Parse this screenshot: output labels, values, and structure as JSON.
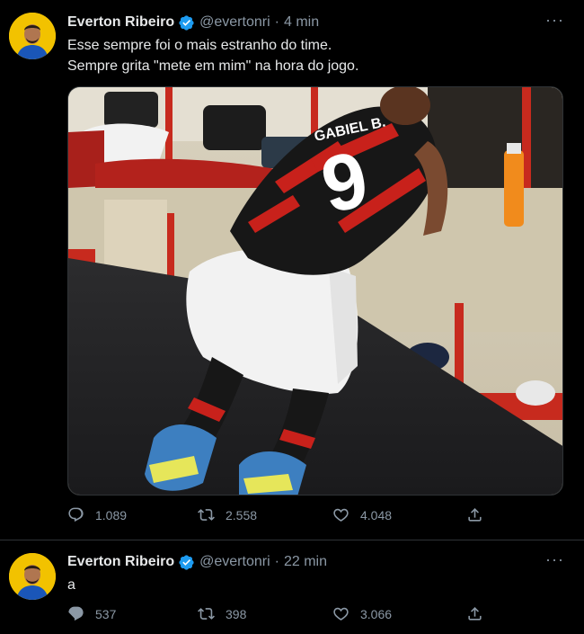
{
  "tweets": [
    {
      "author_name": "Everton Ribeiro",
      "handle": "@evertonri",
      "separator": "·",
      "time": "4 min",
      "text": "Esse sempre foi o mais estranho do time.\nSempre grita \"mete em mim\" na hora do jogo.",
      "media": {
        "description": "photo",
        "jersey_name": "GABIEL B.",
        "jersey_number": "9"
      },
      "replies": "1.089",
      "retweets": "2.558",
      "likes": "4.048"
    },
    {
      "author_name": "Everton Ribeiro",
      "handle": "@evertonri",
      "separator": "·",
      "time": "22 min",
      "text": "a",
      "replies": "537",
      "retweets": "398",
      "likes": "3.066"
    }
  ],
  "more_label": "···",
  "icons": {
    "verified": "verified-badge-icon",
    "reply": "reply-icon",
    "retweet": "retweet-icon",
    "like": "heart-icon",
    "share": "share-icon"
  },
  "colors": {
    "background": "#000000",
    "text": "#e7e9ea",
    "muted": "#8b98a5",
    "verified": "#1d9bf0",
    "divider": "#2f3336"
  }
}
